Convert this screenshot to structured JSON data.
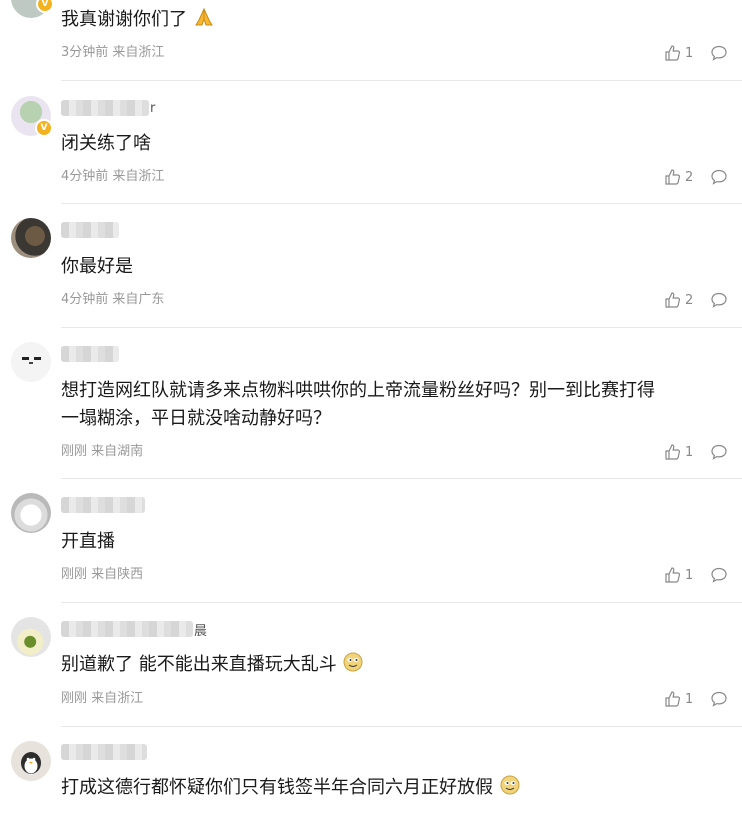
{
  "comments": [
    {
      "name_tail": "",
      "text": "我真谢谢你们了",
      "time": "3分钟前",
      "location": "来自浙江",
      "likes": "1",
      "emoji": "pray",
      "verified": true
    },
    {
      "name_tail": "r",
      "text": "闭关练了啥",
      "time": "4分钟前",
      "location": "来自浙江",
      "likes": "2",
      "verified": true
    },
    {
      "name_tail": "",
      "text": "你最好是",
      "time": "4分钟前",
      "location": "来自广东",
      "likes": "2"
    },
    {
      "name_tail": "",
      "text_lines": [
        "想打造网红队就请多来点物料哄哄你的上帝流量粉丝好吗？别一到比赛打得",
        "一塌糊涂，平日就没啥动静好吗？"
      ],
      "time": "刚刚",
      "location": "来自湖南",
      "likes": "1"
    },
    {
      "name_tail": "",
      "text": "开直播",
      "time": "刚刚",
      "location": "来自陕西",
      "likes": "1"
    },
    {
      "name_tail": "晨",
      "text": "别道歉了 能不能出来直播玩大乱斗",
      "time": "刚刚",
      "location": "来自浙江",
      "likes": "1",
      "emoji": "doge"
    },
    {
      "name_tail": "",
      "text": "打成这德行都怀疑你们只有钱签半年合同六月正好放假",
      "time": "",
      "location": "",
      "likes": "",
      "emoji": "doge"
    }
  ]
}
